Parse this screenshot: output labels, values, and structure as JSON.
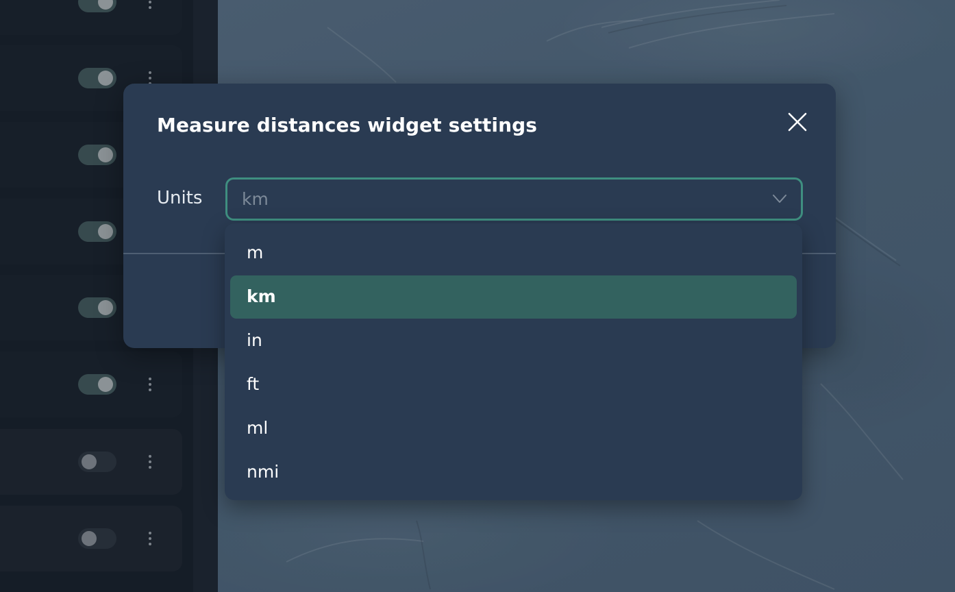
{
  "modal": {
    "title": "Measure distances widget settings",
    "units_label": "Units",
    "selected_value": "km"
  },
  "dropdown": {
    "options": [
      "m",
      "km",
      "in",
      "ft",
      "ml",
      "nmi"
    ],
    "selected_index": 1
  },
  "sidebar": {
    "layers": [
      {
        "enabled": true
      },
      {
        "enabled": true
      },
      {
        "enabled": true
      },
      {
        "enabled": true
      },
      {
        "enabled": true
      },
      {
        "enabled": true
      },
      {
        "enabled": false
      },
      {
        "enabled": false
      }
    ]
  },
  "colors": {
    "modal_bg": "#2a3b52",
    "accent_border": "#3f8f80",
    "selected_option_bg": "#33625f",
    "sidebar_bg": "#171f29",
    "toggle_on": "#3e5356"
  },
  "icons": {
    "close": "close-icon",
    "chevron": "chevron-down-icon",
    "menu": "kebab-menu-icon"
  }
}
